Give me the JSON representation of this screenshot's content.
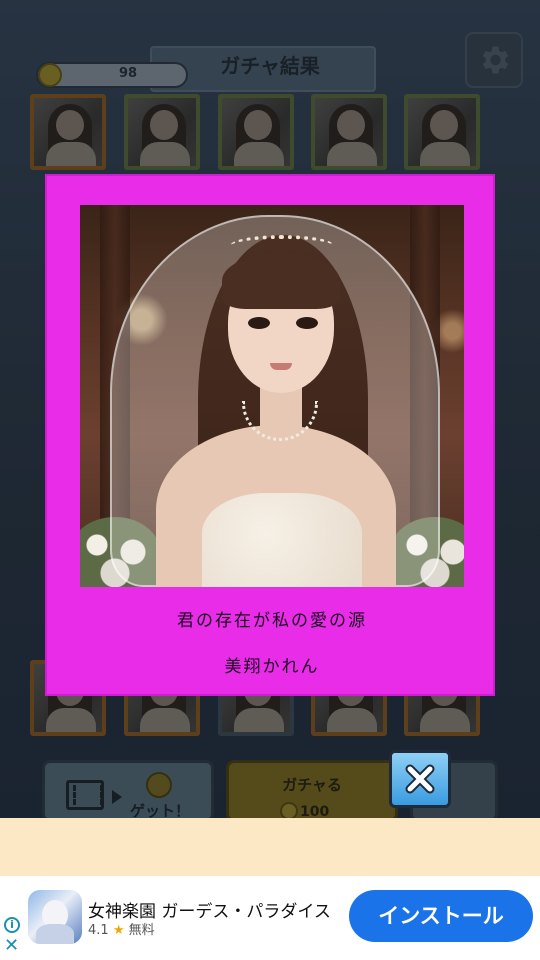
{
  "header": {
    "title": "ガチャ結果"
  },
  "coins": {
    "count": "98"
  },
  "buttons": {
    "ad_label": "ゲット！",
    "gacha_label": "ガチャる",
    "gacha_cost": "100"
  },
  "modal": {
    "quote": "君の存在が私の愛の源",
    "name": "美翔かれん"
  },
  "ad": {
    "title": "女神楽園 ガーデス・パラダイス",
    "rating": "4.1",
    "price": "無料",
    "install_label": "インストール"
  },
  "icons": {
    "settings": "gear-icon",
    "close": "close-icon",
    "coin": "coin-icon",
    "video": "film-icon",
    "ad_info": "info-icon",
    "ad_close": "close-icon"
  },
  "colors": {
    "card": "#e82ce8",
    "close_button": "#3a9be0",
    "install_button": "#1a73e8",
    "ad_space": "#fde8c6"
  }
}
